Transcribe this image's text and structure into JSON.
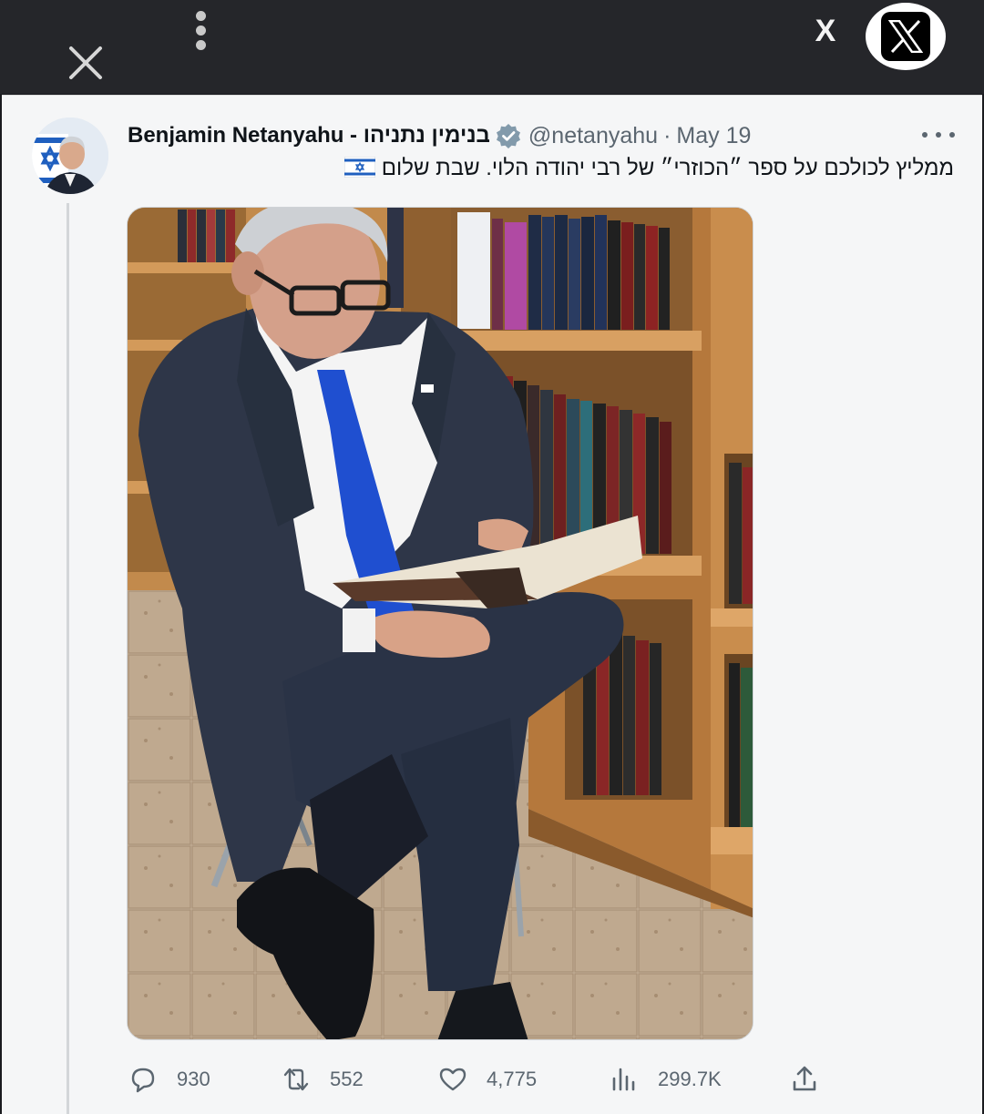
{
  "topbar": {
    "close_icon": "close-icon",
    "menu_icon": "vertical-dots-icon",
    "x_text": "X",
    "logo_icon": "x-logo-icon"
  },
  "tweet": {
    "author_name": "Benjamin Netanyahu - בנימין נתניהו",
    "verified_icon": "verified-badge-icon",
    "handle": "@netanyahu",
    "separator": "·",
    "date": "May 19",
    "text": "ממליץ לכולכם על ספר ״הכוזרי״ של רבי יהודה הלוי. שבת שלום",
    "flag_icon": "israel-flag-icon",
    "image_icon": "photo-of-man-reading-in-library",
    "actions": {
      "replies": "930",
      "reposts": "552",
      "likes": "4,775",
      "views": "299.7K"
    }
  },
  "colors": {
    "topbar": "#25262a",
    "card": "#f5f6f7",
    "text": "#0f1419",
    "muted": "#5b6670",
    "verified": "#829aab"
  }
}
